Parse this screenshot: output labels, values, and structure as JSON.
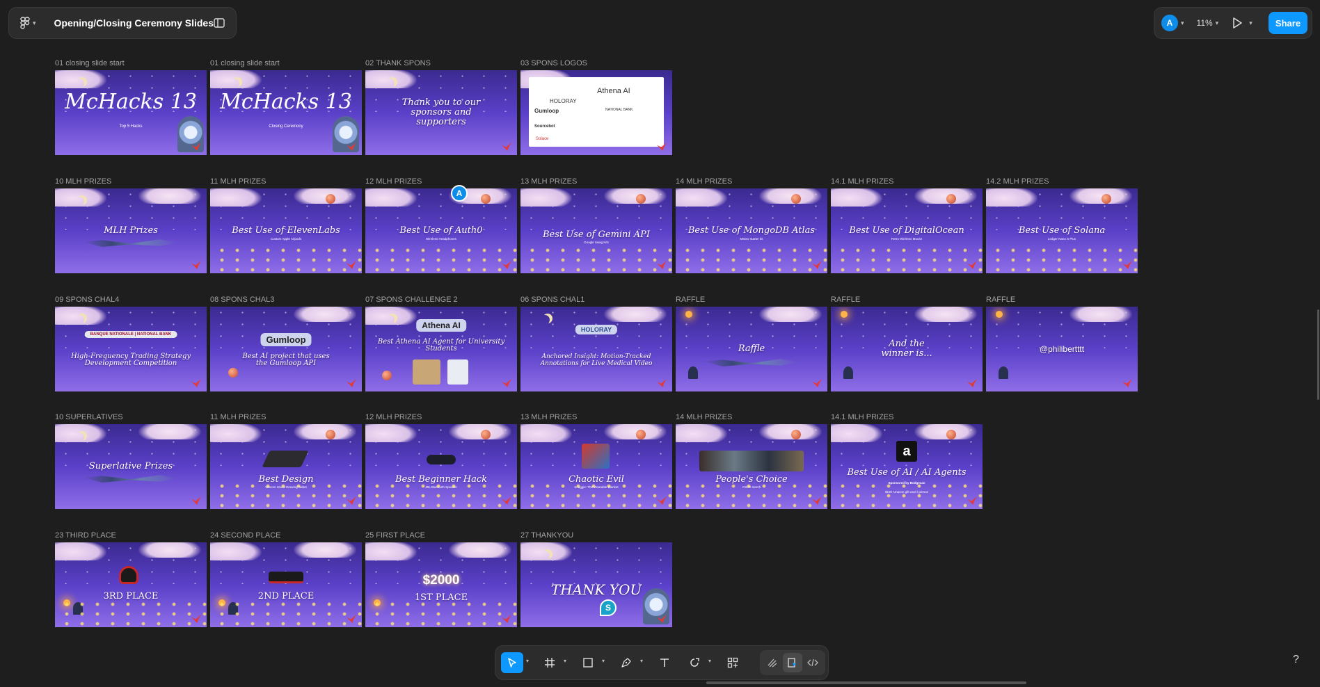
{
  "app": {
    "document_title": "Opening/Closing Ceremony Slides",
    "user_initial": "A",
    "zoom": "11%",
    "share_label": "Share",
    "help_label": "?"
  },
  "colors": {
    "accent": "#0d99ff",
    "canvas": "#1e1e1e",
    "panel": "#2c2c2c",
    "avatar": "#0d8ce9"
  },
  "icons": {
    "main_menu": "figma-logo-icon",
    "sidebar": "sidebar-toggle-icon",
    "present": "play-icon",
    "tools": [
      "move-icon",
      "frame-icon",
      "rectangle-icon",
      "pen-icon",
      "text-icon",
      "shape-icon",
      "actions-icon",
      "draw-icon",
      "design-icon",
      "dev-mode-icon"
    ]
  },
  "collaborators": [
    {
      "initial": "A",
      "color": "#0d8ce9"
    },
    {
      "initial": "S",
      "color": "#1aa3c8"
    }
  ],
  "frames": [
    {
      "label": "01 closing slide start",
      "title": "McHacks 13",
      "sub": "Top 5 Hacks"
    },
    {
      "label": "01 closing slide start",
      "title": "McHacks 13",
      "sub": "Closing Ceremony"
    },
    {
      "label": "02 THANK SPONS",
      "title": "Thank you to our sponsors and supporters"
    },
    {
      "label": "03 SPONS LOGOS",
      "logos": [
        "HOLORAY",
        "Athena AI",
        "Gumloop",
        "NATIONAL BANK",
        "Sourcebot",
        "Solace"
      ]
    },
    {
      "label": "10 MLH PRIZES",
      "title": "MLH Prizes"
    },
    {
      "label": "11 MLH PRIZES",
      "title": "Best Use of ElevenLabs",
      "sub": "Custom Apple Airpods"
    },
    {
      "label": "12 MLH PRIZES",
      "title": "Best Use of Auth0",
      "sub": "Wireless Headphones"
    },
    {
      "label": "13 MLH PRIZES",
      "title": "Best Use of Gemini API",
      "sub": "Google Swag Kits"
    },
    {
      "label": "14 MLH PRIZES",
      "title": "Best Use of MongoDB Atlas",
      "sub": "M5GO starter kit"
    },
    {
      "label": "14.1 MLH PRIZES",
      "title": "Best Use of DigitalOcean",
      "sub": "Retro Wireless Mouse"
    },
    {
      "label": "14.2 MLH PRIZES",
      "title": "Best Use of Solana",
      "sub": "Ledger Nano S Plus"
    },
    {
      "label": "09 SPONS CHAL4",
      "logo": "BANQUE NATIONALE | NATIONAL BANK",
      "title": "High-Frequency Trading Strategy Development Competition"
    },
    {
      "label": "08 SPONS CHAL3",
      "logo": "Gumloop",
      "title": "Best AI project that uses the Gumloop API"
    },
    {
      "label": "07 SPONS CHALLENGE 2",
      "logo": "Athena AI",
      "title": "Best Athena AI Agent for University Students"
    },
    {
      "label": "06 SPONS CHAL1",
      "logo": "HOLORAY",
      "title": "Anchored Insight: Motion-Tracked Annotations for Live Medical Video"
    },
    {
      "label": "RAFFLE",
      "title": "Raffle"
    },
    {
      "label": "RAFFLE",
      "title": "And the winner is..."
    },
    {
      "label": "RAFFLE",
      "title": "@philibertttt"
    },
    {
      "label": "10 SUPERLATIVES",
      "title": "Superlative Prizes"
    },
    {
      "label": "11 MLH PRIZES",
      "title": "Best Design",
      "sub": "Wacom Intuos Drawing Tablet"
    },
    {
      "label": "12 MLH PRIZES",
      "title": "Best Beginner Hack",
      "sub": "JBL Bluetooth Speaker"
    },
    {
      "label": "13 MLH PRIZES",
      "title": "Chaotic Evil",
      "sub": "Snuggie: The Wearable Blanket"
    },
    {
      "label": "14 MLH PRIZES",
      "title": "People's Choice",
      "sub": "CSUS merch"
    },
    {
      "label": "14.1 MLH PRIZES",
      "title": "Best Use of AI / AI Agents",
      "sub": "Sponsored by Bodgecan",
      "sub2": "$100 Amazon gift card / person"
    },
    {
      "label": "23 THIRD PLACE",
      "title": "3RD PLACE"
    },
    {
      "label": "24 SECOND PLACE",
      "title": "2ND PLACE"
    },
    {
      "label": "25 FIRST PLACE",
      "title": "1ST PLACE",
      "amount": "$2000"
    },
    {
      "label": "27 THANKYOU",
      "title": "THANK YOU"
    }
  ]
}
